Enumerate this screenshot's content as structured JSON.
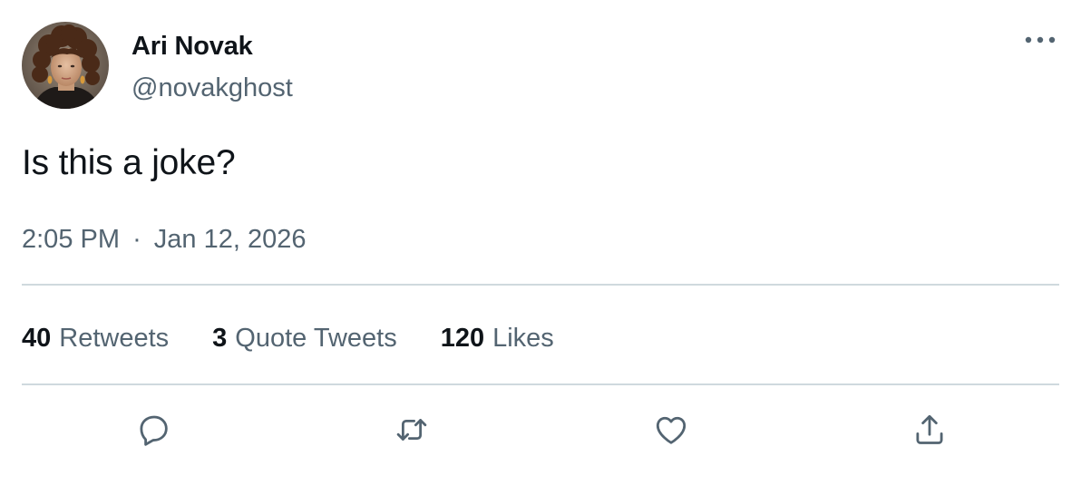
{
  "author": {
    "display_name": "Ari Novak",
    "handle": "@novakghost"
  },
  "tweet": {
    "text": "Is this a joke?",
    "time": "2:05 PM",
    "separator": "·",
    "date": "Jan 12, 2026"
  },
  "stats": {
    "retweets": {
      "count": "40",
      "label": "Retweets"
    },
    "quote_tweets": {
      "count": "3",
      "label": "Quote Tweets"
    },
    "likes": {
      "count": "120",
      "label": "Likes"
    }
  },
  "icons": {
    "more": "more-horizontal-icon",
    "reply": "reply-icon",
    "retweet": "retweet-icon",
    "like": "heart-icon",
    "share": "share-icon"
  },
  "colors": {
    "primary_text": "#0f1419",
    "secondary_text": "#536471",
    "divider": "#cfd9de",
    "background": "#ffffff"
  }
}
